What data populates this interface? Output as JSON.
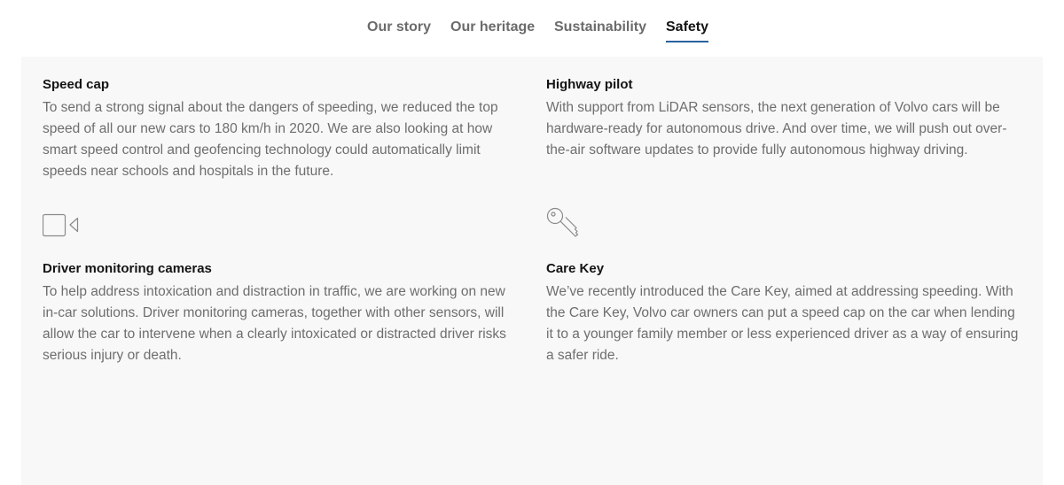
{
  "tabs": [
    {
      "label": "Our story",
      "active": false
    },
    {
      "label": "Our heritage",
      "active": false
    },
    {
      "label": "Sustainability",
      "active": false
    },
    {
      "label": "Safety",
      "active": true
    }
  ],
  "accent_color": "#2a609d",
  "cards": [
    {
      "title": "Speed cap",
      "body": "To send a strong signal about the dangers of speeding, we reduced the top speed of all our new cars to 180 km/h in 2020. We are also looking at how smart speed control and geofencing technology could automatically limit speeds near schools and hospitals in the future."
    },
    {
      "title": "Highway pilot",
      "body": "With support from LiDAR sensors, the next generation of Volvo cars will be hardware-ready for autonomous drive. And over time, we will push out over-the-air software updates to provide fully autonomous highway driving."
    },
    {
      "icon": "video-camera-icon",
      "title": "Driver monitoring cameras",
      "body": "To help address intoxication and distraction in traffic, we are working on new in-car solutions. Driver monitoring cameras, together with other sensors, will allow the car to intervene when a clearly intoxicated or distracted driver risks serious injury or death."
    },
    {
      "icon": "key-icon",
      "title": "Care Key",
      "body": "We’ve recently introduced the Care Key, aimed at addressing speeding. With the Care Key, Volvo car owners can put a speed cap on the car when lending it to a younger family member or less experienced driver as a way of ensuring a safer ride."
    }
  ]
}
